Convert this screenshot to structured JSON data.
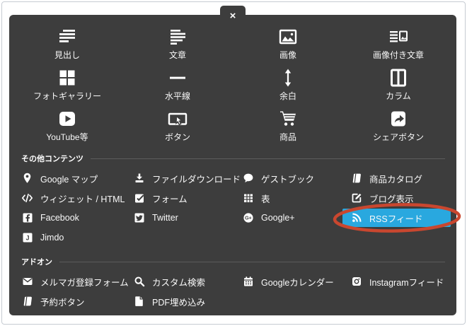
{
  "colors": {
    "panel_bg": "#3d3d3d",
    "highlight": "#29a8df",
    "annotation": "#c9472f",
    "text": "#f8f8f8",
    "header_line": "#5c5c5c"
  },
  "close": {
    "label": "×"
  },
  "grid": {
    "items": [
      {
        "name": "heading",
        "icon": "heading-icon",
        "label": "見出し"
      },
      {
        "name": "text",
        "icon": "text-icon",
        "label": "文章"
      },
      {
        "name": "image",
        "icon": "image-icon",
        "label": "画像"
      },
      {
        "name": "image-text",
        "icon": "image-text-icon",
        "label": "画像付き文章"
      },
      {
        "name": "photo-gallery",
        "icon": "gallery-icon",
        "label": "フォトギャラリー"
      },
      {
        "name": "horizontal-rule",
        "icon": "hr-icon",
        "label": "水平線"
      },
      {
        "name": "spacing",
        "icon": "spacing-icon",
        "label": "余白"
      },
      {
        "name": "columns",
        "icon": "columns-icon",
        "label": "カラム"
      },
      {
        "name": "youtube",
        "icon": "video-icon",
        "label": "YouTube等"
      },
      {
        "name": "button",
        "icon": "button-icon",
        "label": "ボタン"
      },
      {
        "name": "store-item",
        "icon": "cart-icon",
        "label": "商品"
      },
      {
        "name": "share-button",
        "icon": "share-icon",
        "label": "シェアボタン"
      }
    ]
  },
  "sections": [
    {
      "title": "その他コンテンツ",
      "items": [
        {
          "name": "google-maps",
          "icon": "map-pin-icon",
          "label": "Google マップ"
        },
        {
          "name": "file-download",
          "icon": "download-icon",
          "label": "ファイルダウンロード"
        },
        {
          "name": "guestbook",
          "icon": "speech-bubble-icon",
          "label": "ゲストブック"
        },
        {
          "name": "product-catalog",
          "icon": "catalog-icon",
          "label": "商品カタログ"
        },
        {
          "name": "widget-html",
          "icon": "code-icon",
          "label": "ウィジェット / HTML"
        },
        {
          "name": "form",
          "icon": "form-icon",
          "label": "フォーム"
        },
        {
          "name": "table",
          "icon": "table-icon",
          "label": "表"
        },
        {
          "name": "blog-display",
          "icon": "blog-icon",
          "label": "ブログ表示"
        },
        {
          "name": "facebook",
          "icon": "facebook-icon",
          "label": "Facebook"
        },
        {
          "name": "twitter",
          "icon": "twitter-icon",
          "label": "Twitter"
        },
        {
          "name": "google-plus",
          "icon": "google-plus-icon",
          "label": "Google+"
        },
        {
          "name": "rss-feed",
          "icon": "rss-icon",
          "label": "RSSフィード",
          "highlighted": true,
          "annotated": true
        },
        {
          "name": "jimdo",
          "icon": "jimdo-icon",
          "label": "Jimdo"
        }
      ]
    },
    {
      "title": "アドオン",
      "items": [
        {
          "name": "newsletter-form",
          "icon": "envelope-icon",
          "label": "メルマガ登録フォーム"
        },
        {
          "name": "custom-search",
          "icon": "search-icon",
          "label": "カスタム検索"
        },
        {
          "name": "google-calendar",
          "icon": "calendar-icon",
          "label": "Googleカレンダー"
        },
        {
          "name": "instagram-feed",
          "icon": "instagram-icon",
          "label": "Instagramフィード"
        },
        {
          "name": "booking-button",
          "icon": "book-icon",
          "label": "予約ボタン"
        },
        {
          "name": "pdf-embed",
          "icon": "pdf-icon",
          "label": "PDF埋め込み"
        }
      ]
    }
  ],
  "annotation": {
    "shape": "ellipse",
    "target": "RSSフィード",
    "color": "#c9472f"
  }
}
